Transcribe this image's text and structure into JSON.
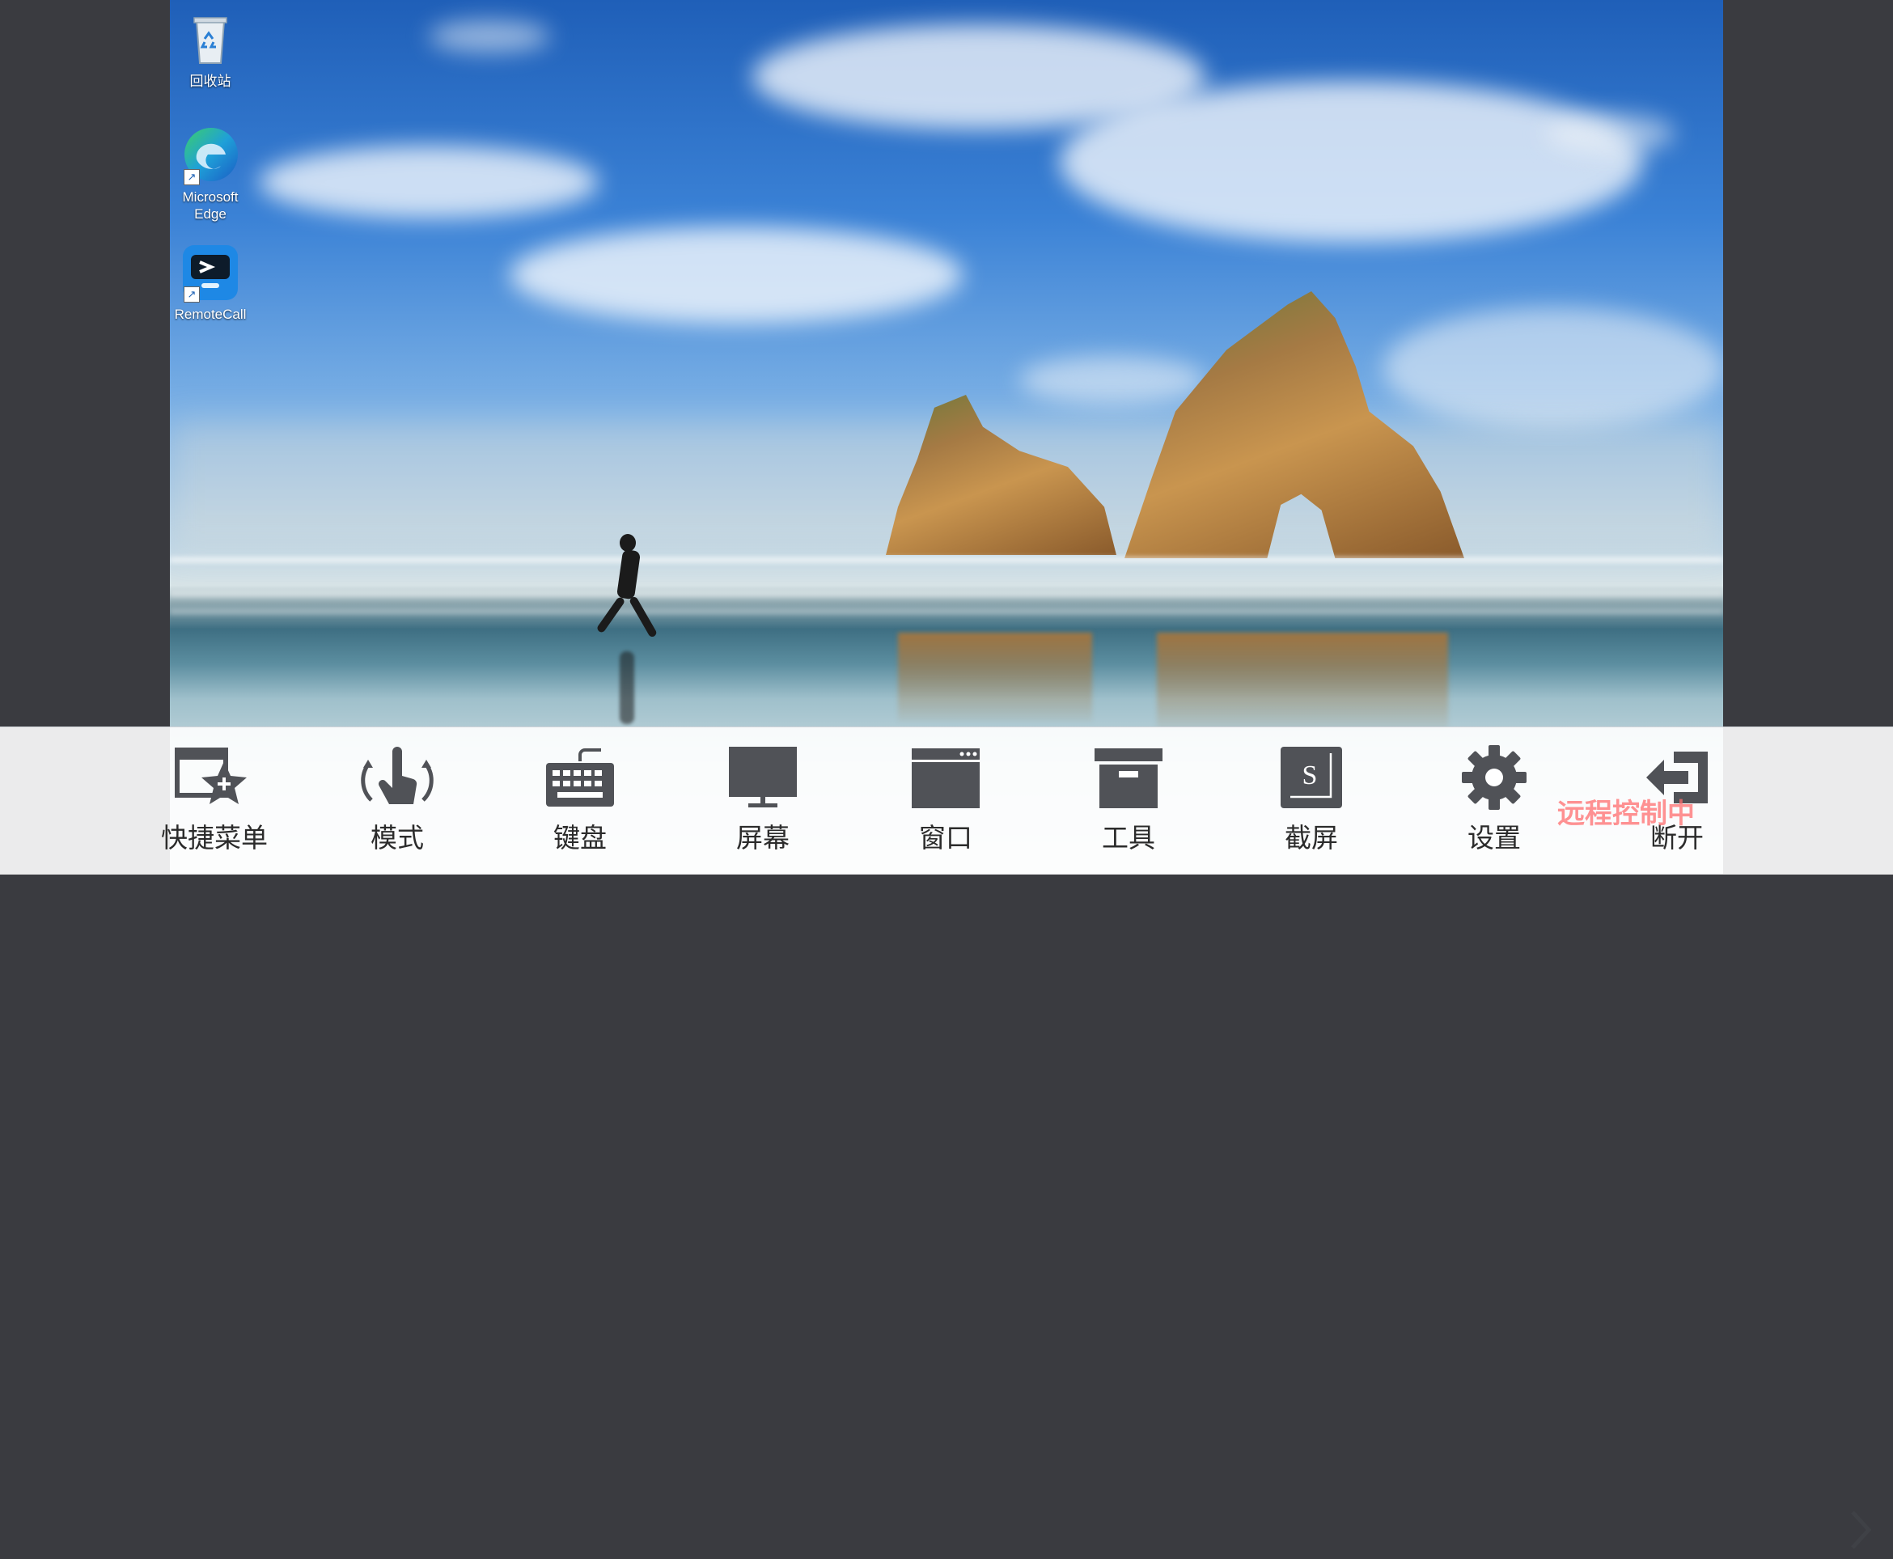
{
  "desktop": {
    "icons": [
      {
        "label": "回收站",
        "icon": "recycle-bin-icon"
      },
      {
        "label": "Microsoft Edge",
        "icon": "edge-icon"
      },
      {
        "label": "RemoteCall",
        "icon": "remotecall-icon"
      }
    ]
  },
  "toolbar": {
    "items": [
      {
        "label": "快捷菜单",
        "icon": "shortcut-menu-icon"
      },
      {
        "label": "模式",
        "icon": "touch-mode-icon"
      },
      {
        "label": "键盘",
        "icon": "keyboard-icon"
      },
      {
        "label": "屏幕",
        "icon": "monitor-icon"
      },
      {
        "label": "窗口",
        "icon": "window-icon"
      },
      {
        "label": "工具",
        "icon": "toolbox-icon"
      },
      {
        "label": "截屏",
        "icon": "screenshot-icon"
      },
      {
        "label": "设置",
        "icon": "gear-icon"
      },
      {
        "label": "断开",
        "icon": "disconnect-icon"
      }
    ],
    "next": "chevron-right-icon"
  },
  "watermark": "远程控制中",
  "colors": {
    "toolbar_bg": "#f2f3f5",
    "icon_color": "#505257",
    "watermark": "#ff6e6e"
  }
}
